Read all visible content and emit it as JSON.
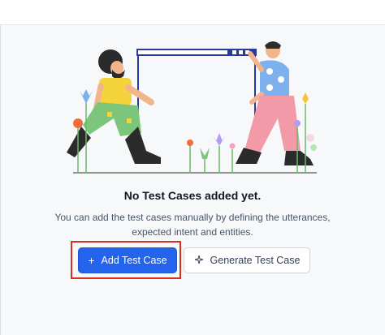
{
  "empty_state": {
    "title": "No Test Cases added yet.",
    "description": "You can add the test cases manually by defining the utterances, expected intent and entities."
  },
  "actions": {
    "add_label": "Add Test Case",
    "add_icon": "plus-icon",
    "generate_label": "Generate Test Case",
    "generate_icon": "sparkle-icon"
  },
  "colors": {
    "primary": "#2463eb",
    "highlight": "#d92d20"
  }
}
